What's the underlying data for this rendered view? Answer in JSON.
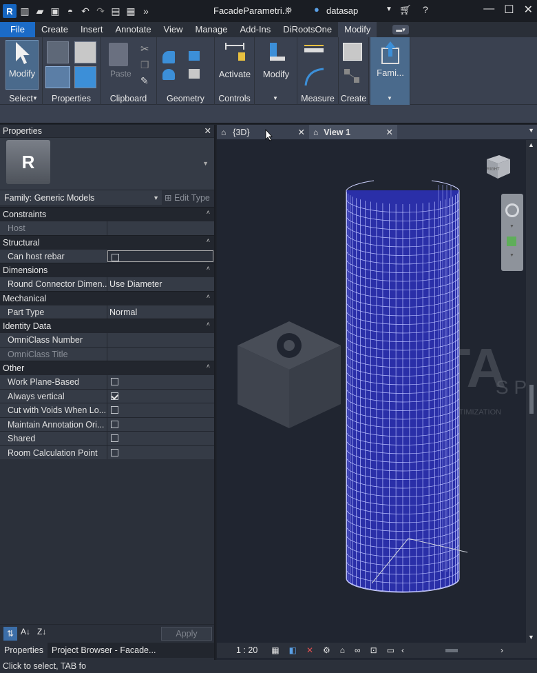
{
  "title_bar": {
    "file_title": "FacadeParametri...",
    "user_name": "datasap",
    "app_logo_letter": "R"
  },
  "menu": {
    "tabs": [
      "File",
      "Create",
      "Insert",
      "Annotate",
      "View",
      "Manage",
      "Add-Ins",
      "DiRootsOne",
      "Modify"
    ],
    "active": "Modify"
  },
  "ribbon": {
    "select_group": {
      "button": "Modify",
      "label": "Select"
    },
    "properties_group": {
      "label": "Properties"
    },
    "clipboard_group": {
      "paste": "Paste",
      "label": "Clipboard"
    },
    "geometry_group": {
      "label": "Geometry"
    },
    "controls_group": {
      "button": "Activate",
      "label": "Controls"
    },
    "modify_group": {
      "button": "Modify"
    },
    "measure_group": {
      "label": "Measure"
    },
    "create_group": {
      "label": "Create"
    },
    "family_group": {
      "button": "Fami..."
    }
  },
  "properties_panel": {
    "title": "Properties",
    "logo_letter": "R",
    "family_selector": "Family: Generic Models",
    "edit_type": "Edit Type",
    "categories": [
      {
        "name": "Constraints",
        "rows": [
          {
            "label": "Host",
            "value": "",
            "dim": true
          }
        ]
      },
      {
        "name": "Structural",
        "rows": [
          {
            "label": "Can host rebar",
            "checkbox": false,
            "boxed": true
          }
        ]
      },
      {
        "name": "Dimensions",
        "rows": [
          {
            "label": "Round Connector Dimen...",
            "value": "Use Diameter"
          }
        ]
      },
      {
        "name": "Mechanical",
        "rows": [
          {
            "label": "Part Type",
            "value": "Normal"
          }
        ]
      },
      {
        "name": "Identity Data",
        "rows": [
          {
            "label": "OmniClass Number",
            "value": ""
          },
          {
            "label": "OmniClass Title",
            "value": "",
            "dim": true
          }
        ]
      },
      {
        "name": "Other",
        "rows": [
          {
            "label": "Work Plane-Based",
            "checkbox": false
          },
          {
            "label": "Always vertical",
            "checkbox": true
          },
          {
            "label": "Cut with Voids When Lo...",
            "checkbox": false
          },
          {
            "label": "Maintain Annotation Ori...",
            "checkbox": false
          },
          {
            "label": "Shared",
            "checkbox": false
          },
          {
            "label": "Room Calculation Point",
            "checkbox": false
          }
        ]
      }
    ],
    "apply": "Apply",
    "bottom_tabs": [
      "Properties",
      "Project Browser - Facade..."
    ]
  },
  "view_tabs": [
    {
      "label": "{3D}",
      "active": false
    },
    {
      "label": "View 1",
      "active": true
    }
  ],
  "view_cube_label": "RIGHT",
  "watermark": {
    "letters": "DATA",
    "suffix": "S P",
    "tagline": "DATA, BIM & PROCESS OPTIMIZATION"
  },
  "view_controls": {
    "scale": "1 : 20"
  },
  "status_bar": {
    "text": "Click to select, TAB fo"
  }
}
